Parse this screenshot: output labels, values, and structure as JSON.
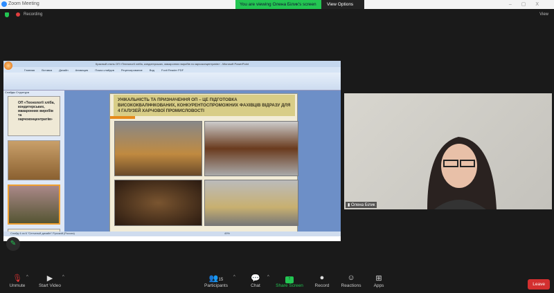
{
  "window": {
    "title": "Zoom Meeting",
    "banner": "You are viewing Олена Білик's screen",
    "view_options": "View Options"
  },
  "topbar": {
    "recording": "Recording",
    "view": "View"
  },
  "ppt": {
    "title": "Красный стиль ОП «Технології хліба, кондитерських, макаронних виробів та харчоконцентратів» - Microsoft PowerPoint",
    "tabs": [
      "Главная",
      "Вставка",
      "Дизайн",
      "Анимация",
      "Показ слайдов",
      "Рецензирование",
      "Вид",
      "Foxit Reader PDF"
    ],
    "panel_tabs": [
      "Слайды",
      "Структура"
    ],
    "thumb1_title": "ОП «Технології хліба, кондитерських, макаронних виробів та харчоконцентратів»",
    "slide_title": "УНІКАЛЬНІСТЬ ТА ПРИЗНАЧЕННЯ ОП – ЦЕ ПІДГОТОВКА ВИСОКОКВАЛІФІКОВАНИХ, КОНКУРЕНТОСПРОМОЖНИХ ФАХІВЦІВ ВІДРАЗУ ДЛЯ 4 ГАЛУЗЕЙ ХАРЧОВОЇ ПРОМИСЛОВОСТІ",
    "status": "Слайд 4 из 6   \"Сетчатый дизайн\"   Русский (Россия)",
    "zoom": "49%"
  },
  "participant": {
    "name": "Олена Білик"
  },
  "toolbar": {
    "unmute": "Unmute",
    "start_video": "Start Video",
    "participants": "Participants",
    "participants_count": "15",
    "chat": "Chat",
    "share_screen": "Share Screen",
    "record": "Record",
    "reactions": "Reactions",
    "apps": "Apps",
    "leave": "Leave"
  }
}
